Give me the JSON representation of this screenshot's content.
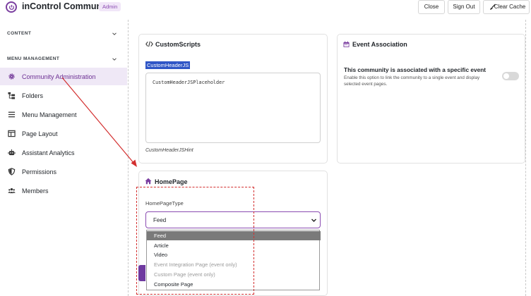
{
  "header": {
    "app_title": "inControl Community",
    "badge": "Admin",
    "close_label": "Close",
    "signout_label": "Sign Out",
    "clear_cache_label": "Clear Cache"
  },
  "sidebar": {
    "content_heading": "CONTENT",
    "menu_heading": "MENU MANAGEMENT",
    "items": [
      {
        "label": "Community Administration",
        "icon": "gear-icon",
        "active": true
      },
      {
        "label": "Folders",
        "icon": "folder-tree-icon"
      },
      {
        "label": "Menu Management",
        "icon": "menu-lines-icon"
      },
      {
        "label": "Page Layout",
        "icon": "page-layout-icon"
      },
      {
        "label": "Assistant Analytics",
        "icon": "robot-icon"
      },
      {
        "label": "Permissions",
        "icon": "shield-icon"
      },
      {
        "label": "Members",
        "icon": "users-icon"
      }
    ]
  },
  "custom_scripts": {
    "title": "CustomScripts",
    "field_label": "CustomHeaderJS",
    "placeholder": "CustomHeaderJSPlaceholder",
    "hint": "CustomHeaderJSHint"
  },
  "event_association": {
    "title": "Event Association",
    "toggle_title": "This community is associated with a specific event",
    "toggle_desc": "Enable this option to link the community to a single event and display selected event pages.",
    "enabled": false
  },
  "homepage": {
    "title": "HomePage",
    "type_label": "HomePageType",
    "selected": "Feed",
    "options": [
      {
        "label": "Feed",
        "selected": true
      },
      {
        "label": "Article"
      },
      {
        "label": "Video"
      },
      {
        "label": "Event Integration Page (event only)",
        "disabled": true
      },
      {
        "label": "Custom Page (event only)",
        "disabled": true
      },
      {
        "label": "Composite Page"
      }
    ]
  },
  "colors": {
    "accent": "#6c2f93",
    "highlight": "#2f56c6",
    "annotation": "#d32f2f"
  }
}
